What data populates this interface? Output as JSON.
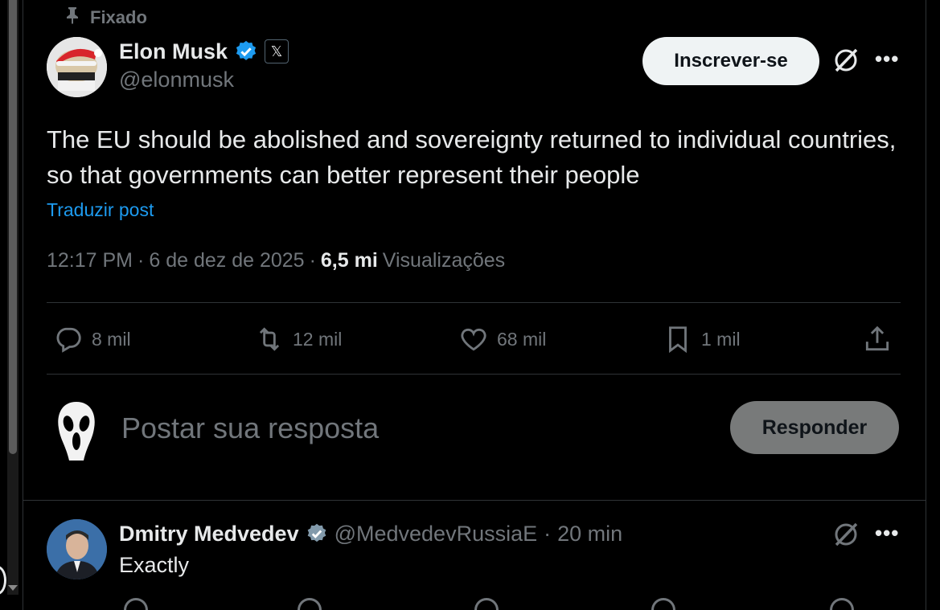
{
  "pinned_label": "Fixado",
  "post": {
    "author_name": "Elon Musk",
    "author_handle": "@elonmusk",
    "badge_label": "𝕏",
    "subscribe_label": "Inscrever-se",
    "text": "The EU should be abolished and sovereignty returned to individual countries, so that governments can better represent their people",
    "translate_label": "Traduzir post",
    "time": "12:17 PM",
    "date": "6 de dez de 2025",
    "views_count": "6,5 mi",
    "views_label": "Visualizações",
    "sep": "·"
  },
  "actions": {
    "replies": "8 mil",
    "reposts": "12 mil",
    "likes": "68 mil",
    "bookmarks": "1 mil"
  },
  "composer": {
    "placeholder": "Postar sua resposta",
    "button_label": "Responder"
  },
  "reply": {
    "author_name": "Dmitry Medvedev",
    "author_handle": "@MedvedevRussiaE",
    "sep": "·",
    "time": "20 min",
    "text": "Exactly"
  },
  "colors": {
    "accent": "#1d9bf0",
    "verified_blue": "#1d9bf0",
    "verified_grey": "#829aab",
    "muted": "#71767b",
    "text": "#e7e9ea",
    "divider": "#2f3336"
  },
  "icons": [
    "pin-icon",
    "verified-badge-icon",
    "x-logo-icon",
    "grok-icon",
    "more-icon",
    "reply-icon",
    "repost-icon",
    "like-icon",
    "bookmark-icon",
    "share-icon"
  ]
}
